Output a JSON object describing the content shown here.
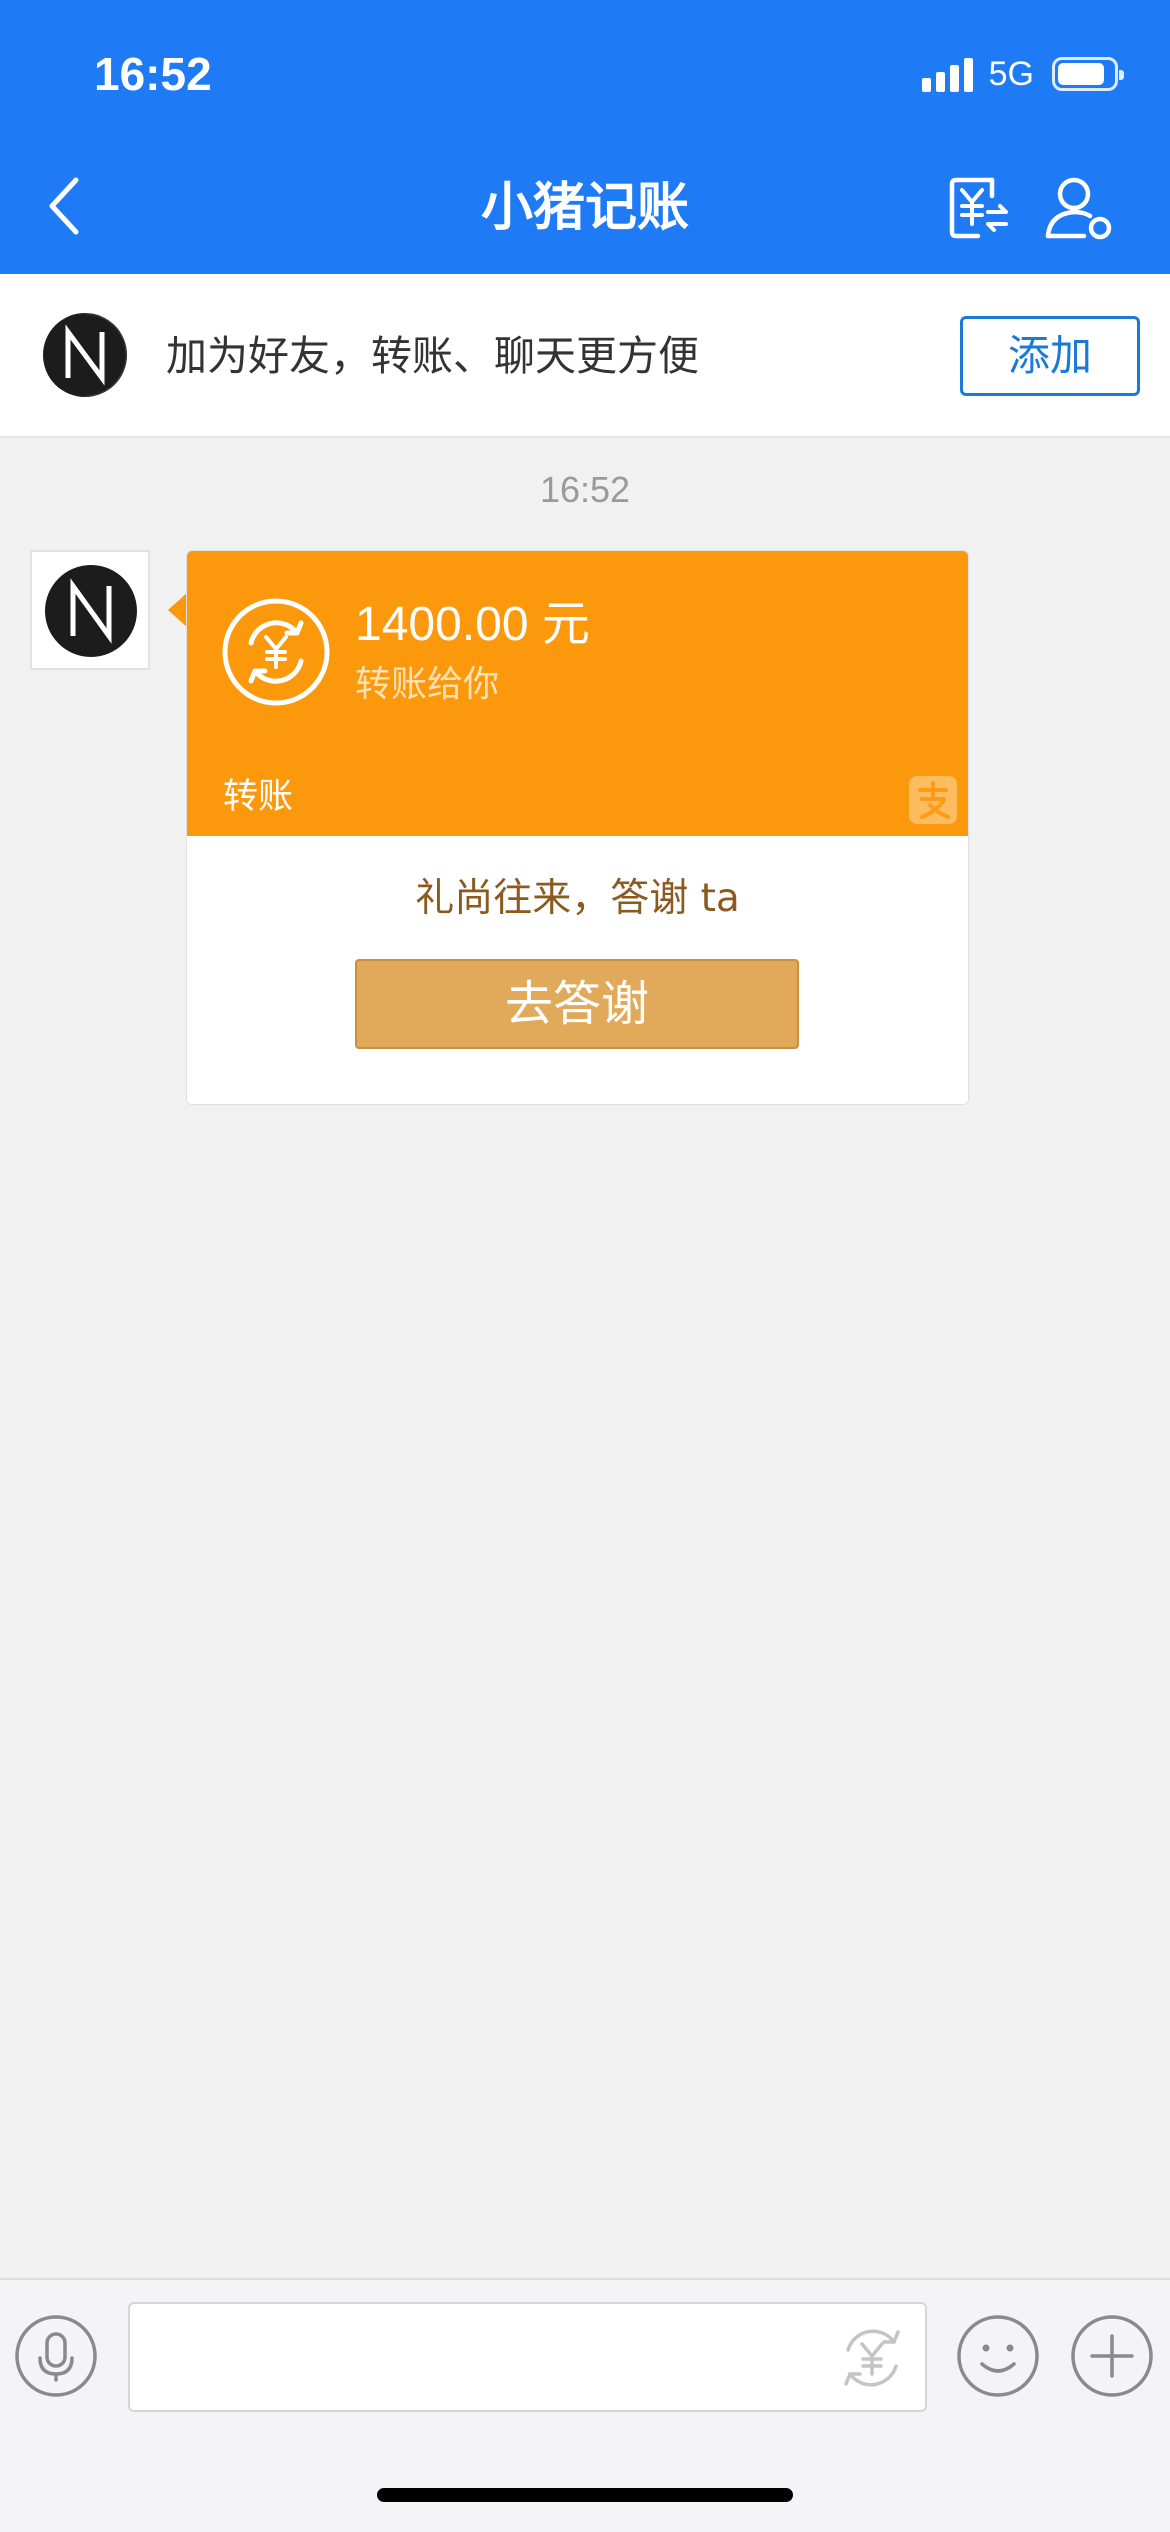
{
  "status_bar": {
    "time": "16:52",
    "network": "5G",
    "battery_level": 0.85
  },
  "nav": {
    "title": "小猪记账",
    "back_icon": "chevron-left-icon",
    "transfer_icon": "yuan-transfer-icon",
    "profile_icon": "profile-settings-icon"
  },
  "friend_banner": {
    "text": "加为好友，转账、聊天更方便",
    "add_label": "添加"
  },
  "chat": {
    "timestamp": "16:52",
    "message": {
      "amount": "1400.00 元",
      "subtitle": "转账给你",
      "type_label": "转账",
      "thanks_text": "礼尚往来，答谢 ta",
      "thanks_button": "去答谢"
    }
  },
  "input_bar": {
    "placeholder": "",
    "voice_icon": "microphone-icon",
    "yuan_icon": "yuan-icon",
    "emoji_icon": "emoji-icon",
    "plus_icon": "plus-icon"
  },
  "colors": {
    "header_blue": "#1e7bf5",
    "transfer_orange": "#fc980c",
    "thanks_gold": "#e1aa5b",
    "link_blue": "#1b7ad6"
  }
}
